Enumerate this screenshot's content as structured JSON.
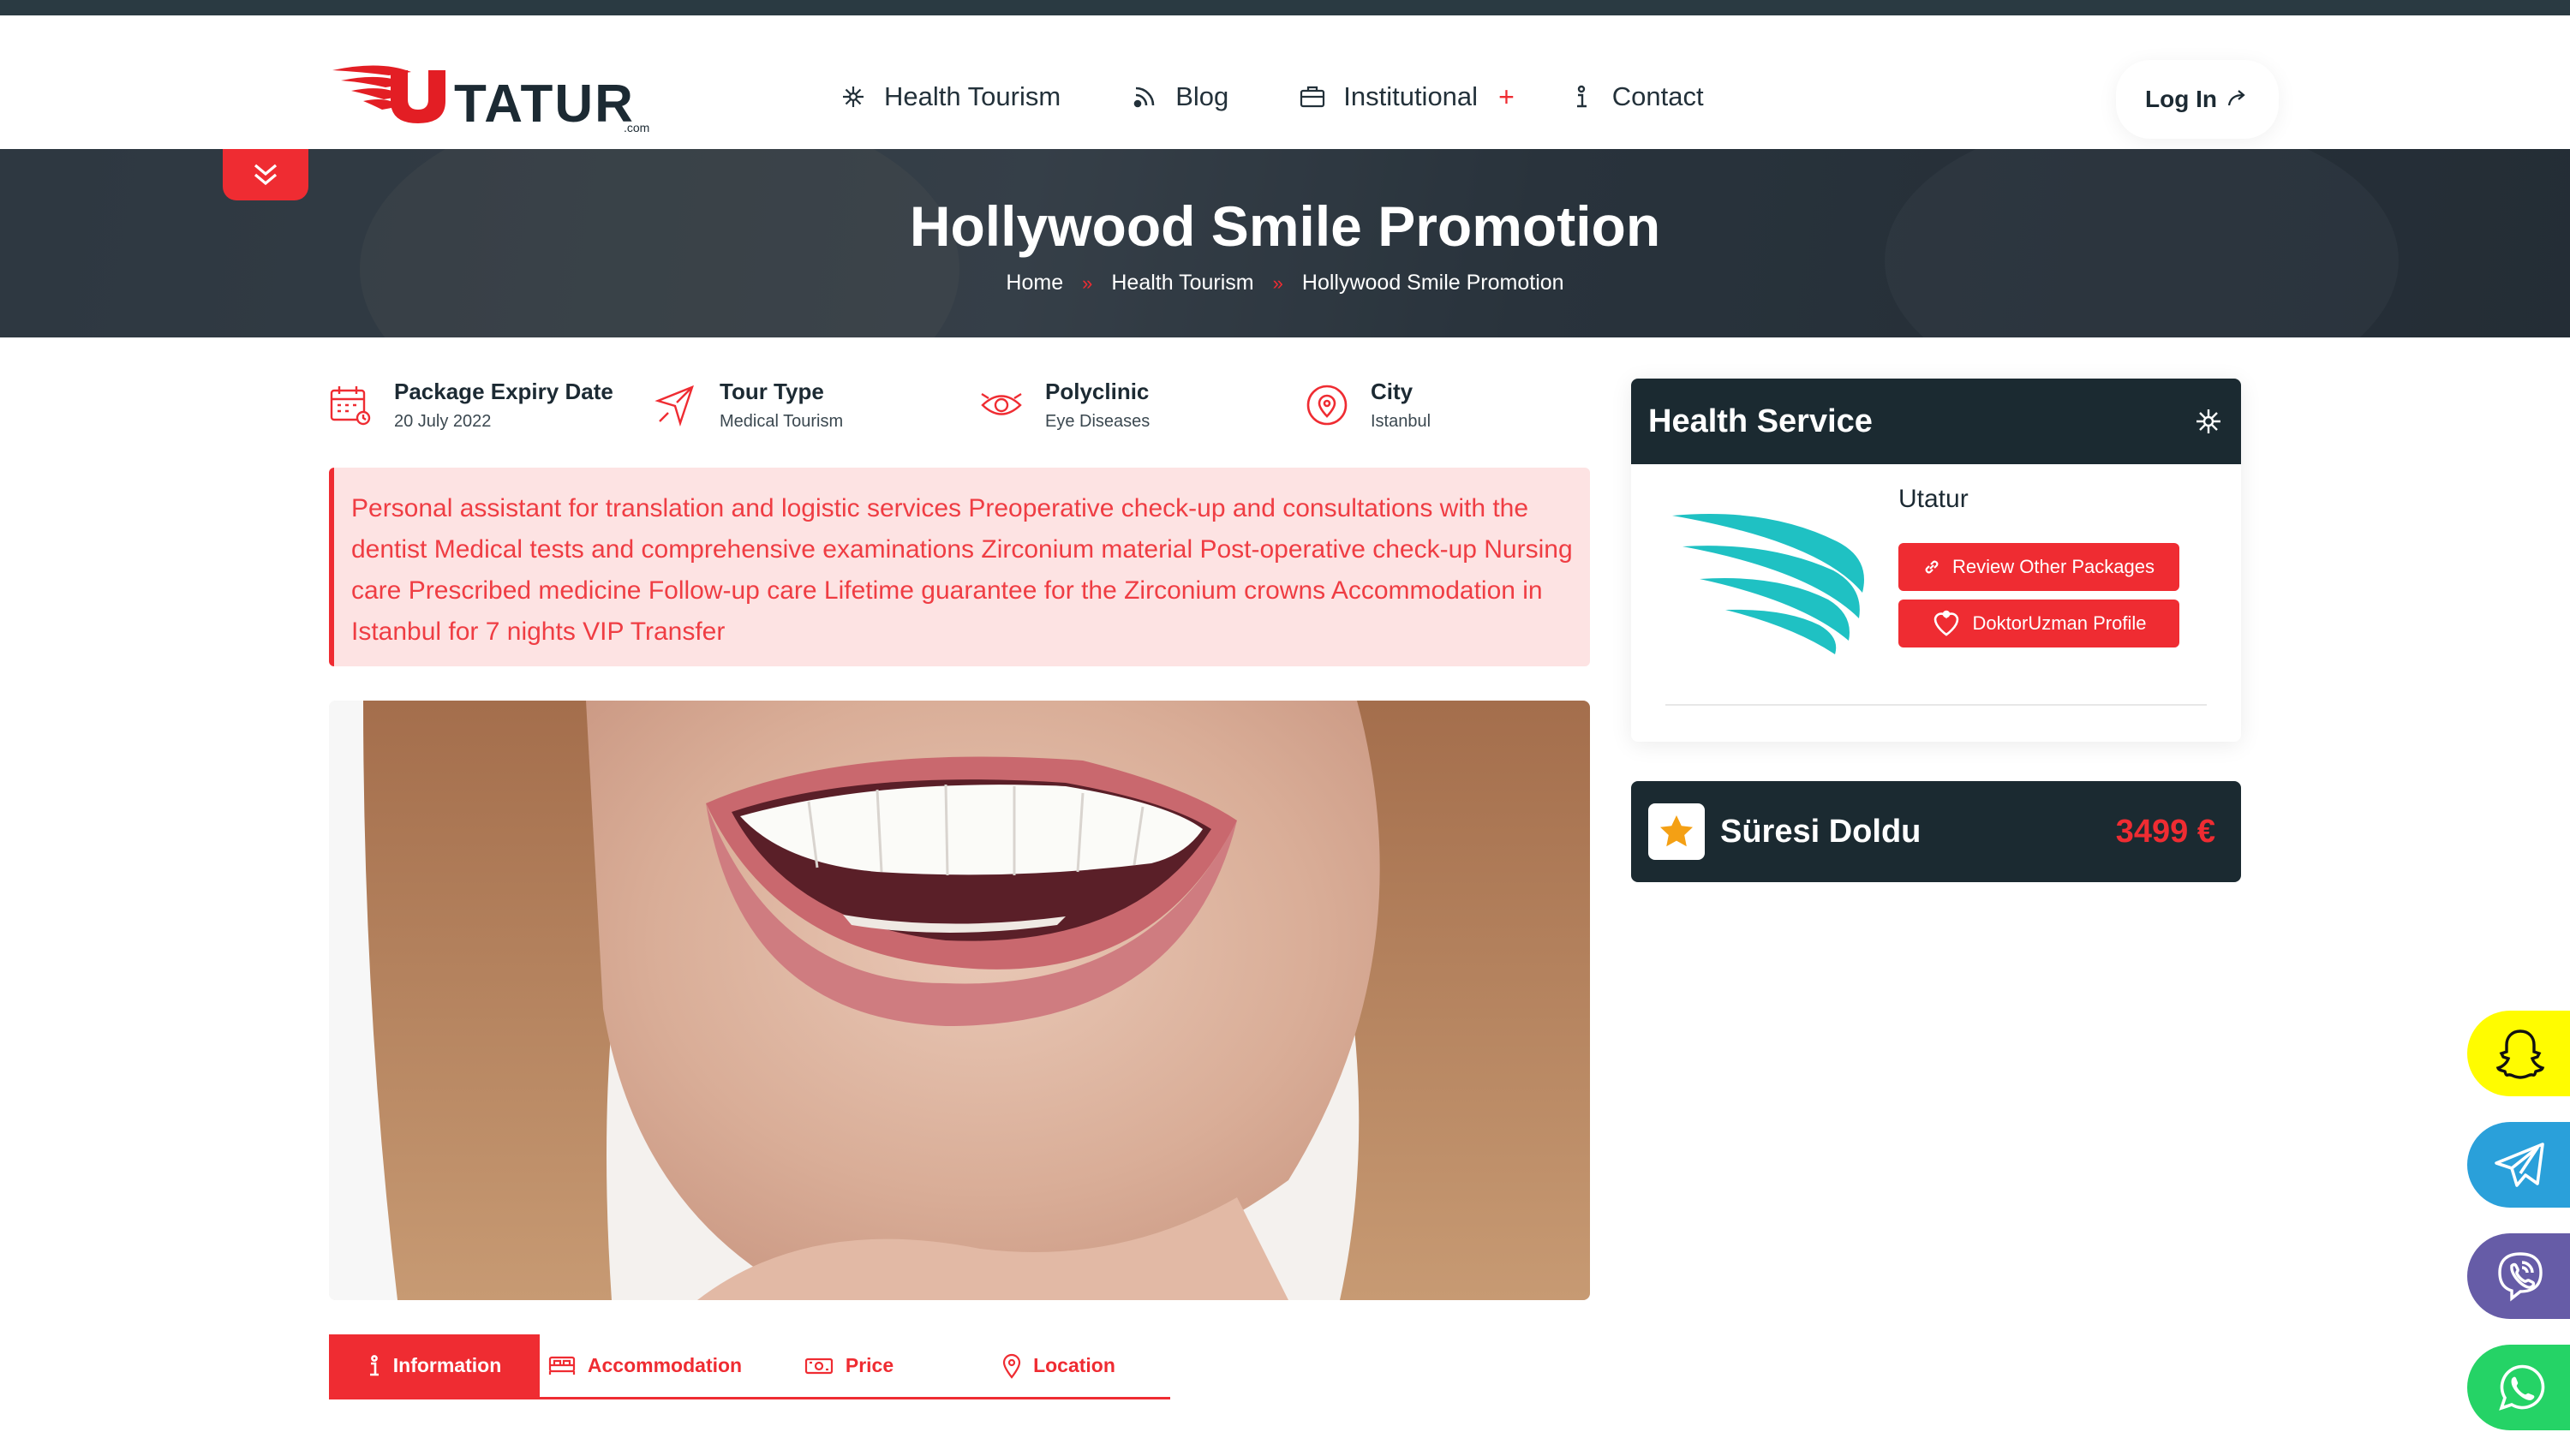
{
  "brand": {
    "name": "UTATUR",
    "domain": ".com",
    "accent": "#ef2c32",
    "dark": "#1b2a31"
  },
  "nav": {
    "items": [
      {
        "label": "Health Tourism",
        "icon": "asterisk-icon"
      },
      {
        "label": "Blog",
        "icon": "rss-icon"
      },
      {
        "label": "Institutional",
        "icon": "briefcase-icon",
        "suffix": "+"
      },
      {
        "label": "Contact",
        "icon": "info-icon"
      }
    ],
    "login": "Log In"
  },
  "banner": {
    "title": "Hollywood Smile Promotion",
    "breadcrumb": [
      "Home",
      "Health Tourism",
      "Hollywood Smile Promotion"
    ]
  },
  "info": [
    {
      "title": "Package Expiry Date",
      "value": "20 July 2022",
      "icon": "calendar-icon"
    },
    {
      "title": "Tour Type",
      "value": "Medical Tourism",
      "icon": "plane-icon"
    },
    {
      "title": "Polyclinic",
      "value": "Eye Diseases",
      "icon": "eye-icon"
    },
    {
      "title": "City",
      "value": "Istanbul",
      "icon": "location-pin-icon"
    }
  ],
  "description": "Personal assistant for translation and logistic services Preoperative check-up and consultations with the dentist Medical tests and comprehensive examinations Zirconium material Post-operative check-up Nursing care Prescribed medicine Follow-up care Lifetime guarantee for the Zirconium crowns Accommodation in Istanbul for 7 nights VIP Transfer",
  "tabs": [
    {
      "label": "Information",
      "icon": "info-icon",
      "active": true
    },
    {
      "label": "Accommodation",
      "icon": "bed-icon"
    },
    {
      "label": "Price",
      "icon": "money-icon"
    },
    {
      "label": "Location",
      "icon": "location-pin-icon"
    }
  ],
  "sidebar": {
    "title": "Health Service",
    "provider": "Utatur",
    "review_button": "Review Other Packages",
    "profile_button": "DoktorUzman Profile"
  },
  "price_card": {
    "status": "Süresi Doldu",
    "price": "3499 €"
  },
  "social": [
    {
      "name": "snapchat",
      "color": "#fffc00"
    },
    {
      "name": "telegram",
      "color": "#2aa0da"
    },
    {
      "name": "viber",
      "color": "#665ca7"
    },
    {
      "name": "whatsapp",
      "color": "#25d366"
    }
  ]
}
